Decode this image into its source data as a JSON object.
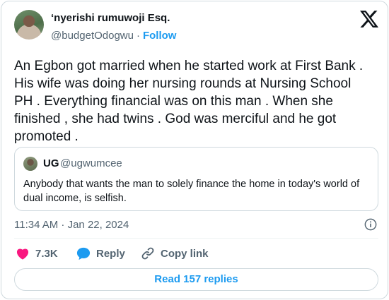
{
  "author": {
    "display_name": "‘nyerishi rumuwoji Esq.",
    "handle": "@budgetOdogwu",
    "separator": "·",
    "follow_label": "Follow"
  },
  "tweet": {
    "text": "An Egbon got married when he started work at First Bank .\nHis wife was doing her nursing rounds at Nursing School\nPH . Everything financial was on this man . When she\nfinished , she had twins . God was merciful and he got\npromoted ."
  },
  "quoted_tweet": {
    "display_name": "UG",
    "handle": "@ugwumcee",
    "text": "Anybody that wants the man to solely finance the home in today's world of dual income, is selfish."
  },
  "timestamp": "11:34 AM · Jan 22, 2024",
  "actions": {
    "like_count": "7.3K",
    "reply_label": "Reply",
    "copy_label": "Copy link"
  },
  "replies_button_label": "Read 157 replies",
  "icons": [
    "x-logo-icon",
    "info-icon",
    "heart-icon",
    "reply-bubble-icon",
    "link-icon"
  ],
  "colors": {
    "accent": "#1d9bf0",
    "like": "#f91880",
    "muted": "#536471",
    "text": "#0f1419"
  }
}
